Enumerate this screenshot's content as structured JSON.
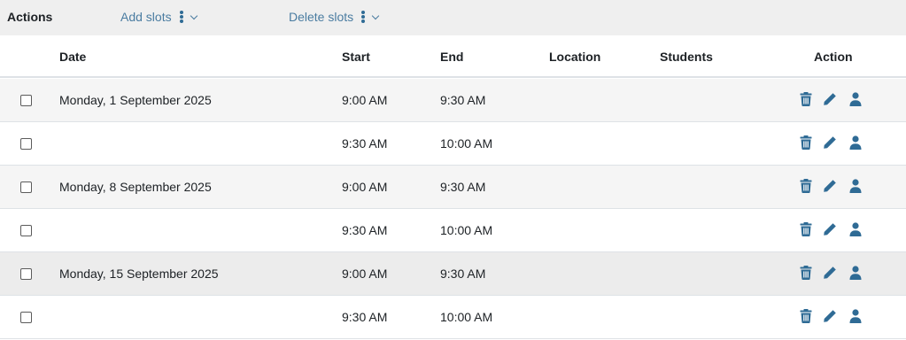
{
  "toolbar": {
    "actions_label": "Actions",
    "add_slots": "Add slots",
    "delete_slots": "Delete slots"
  },
  "columns": {
    "date": "Date",
    "start": "Start",
    "end": "End",
    "location": "Location",
    "students": "Students",
    "action": "Action"
  },
  "rows": [
    {
      "date": "Monday, 1 September 2025",
      "start": "9:00 AM",
      "end": "9:30 AM",
      "location": "",
      "students": ""
    },
    {
      "date": "",
      "start": "9:30 AM",
      "end": "10:00 AM",
      "location": "",
      "students": ""
    },
    {
      "date": "Monday, 8 September 2025",
      "start": "9:00 AM",
      "end": "9:30 AM",
      "location": "",
      "students": ""
    },
    {
      "date": "",
      "start": "9:30 AM",
      "end": "10:00 AM",
      "location": "",
      "students": ""
    },
    {
      "date": "Monday, 15 September 2025",
      "start": "9:00 AM",
      "end": "9:30 AM",
      "location": "",
      "students": ""
    },
    {
      "date": "",
      "start": "9:30 AM",
      "end": "10:00 AM",
      "location": "",
      "students": ""
    }
  ],
  "row_actions": [
    "trash-icon",
    "pencil-icon",
    "user-icon"
  ],
  "colors": {
    "accent": "#2f6b95",
    "link": "#4a7ca1",
    "toolbar_bg": "#efefef",
    "stripe_bg": "#f5f5f5"
  }
}
